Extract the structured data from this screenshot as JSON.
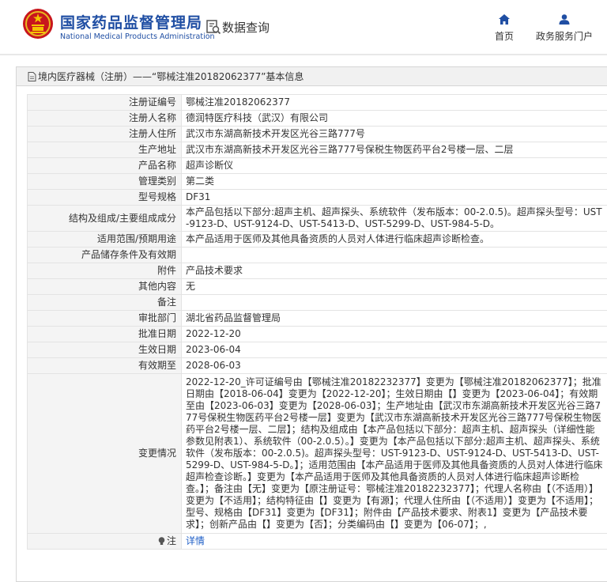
{
  "header": {
    "title": "国家药品监督管理局",
    "subtitle": "National Medical Products Administration",
    "query_label": "数据查询",
    "nav": [
      {
        "label": "首页",
        "icon": "home-icon"
      },
      {
        "label": "政务服务门户",
        "icon": "user-icon"
      }
    ],
    "brand_color": "#1f4ea3"
  },
  "breadcrumb": "境内医疗器械（注册）——“鄂械注准20182062377”基本信息",
  "fields": [
    {
      "label": "注册证编号",
      "value": "鄂械注准20182062377"
    },
    {
      "label": "注册人名称",
      "value": "德润特医疗科技（武汉）有限公司"
    },
    {
      "label": "注册人住所",
      "value": "武汉市东湖高新技术开发区光谷三路777号"
    },
    {
      "label": "生产地址",
      "value": "武汉市东湖高新技术开发区光谷三路777号保税生物医药平台2号楼一层、二层"
    },
    {
      "label": "产品名称",
      "value": "超声诊断仪"
    },
    {
      "label": "管理类别",
      "value": "第二类"
    },
    {
      "label": "型号规格",
      "value": "DF31"
    },
    {
      "label": "结构及组成/主要组成成分",
      "value": "本产品包括以下部分:超声主机、超声探头、系统软件（发布版本：00-2.0.5)。超声探头型号：UST-9123-D、UST-9124-D、UST-5413-D、UST-5299-D、UST-984-5-D。"
    },
    {
      "label": "适用范围/预期用途",
      "value": "本产品适用于医师及其他具备资质的人员对人体进行临床超声诊断检查。"
    },
    {
      "label": "产品储存条件及有效期",
      "value": ""
    },
    {
      "label": "附件",
      "value": "产品技术要求"
    },
    {
      "label": "其他内容",
      "value": "无"
    },
    {
      "label": "备注",
      "value": ""
    },
    {
      "label": "审批部门",
      "value": "湖北省药品监督管理局"
    },
    {
      "label": "批准日期",
      "value": "2022-12-20"
    },
    {
      "label": "生效日期",
      "value": "2023-06-04"
    },
    {
      "label": "有效期至",
      "value": "2028-06-03"
    }
  ],
  "changes": {
    "label": "变更情况",
    "value": "2022-12-20_许可证编号由【鄂械注准20182232377】变更为【鄂械注准20182062377】；批准日期由【2018-06-04】变更为【2022-12-20】；生效日期由【】变更为【2023-06-04】；有效期至由【2023-06-03】变更为【2028-06-03】；生产地址由【武汉市东湖高新技术开发区光谷三路777号保税生物医药平台2号楼一层】变更为【武汉市东湖高新技术开发区光谷三路777号保税生物医药平台2号楼一层、二层】；结构及组成由【本产品包括以下部分：超声主机、超声探头（详细性能参数见附表1）、系统软件（00-2.0.5）。】变更为【本产品包括以下部分:超声主机、超声探头、系统软件（发布版本：00-2.0.5)。超声探头型号：UST-9123-D、UST-9124-D、UST-5413-D、UST-5299-D、UST-984-5-D。】；适用范围由【本产品适用于医师及其他具备资质的人员对人体进行临床超声检查诊断。】变更为【本产品适用于医师及其他具备资质的人员对人体进行临床超声诊断检查。】；备注由【无】变更为【原注册证号：鄂械注准20182232377】；代理人名称由【（不适用）】变更为【不适用】；结构特征由【】变更为【有源】；代理人住所由【（不适用）】变更为【不适用】；型号、规格由【DF31】变更为【DF31】；附件由【产品技术要求、附表1】变更为【产品技术要求】；创新产品由【】变更为【否】；分类编码由【】变更为【06-07】；,"
  },
  "note": {
    "label": "注",
    "link": "详情"
  }
}
